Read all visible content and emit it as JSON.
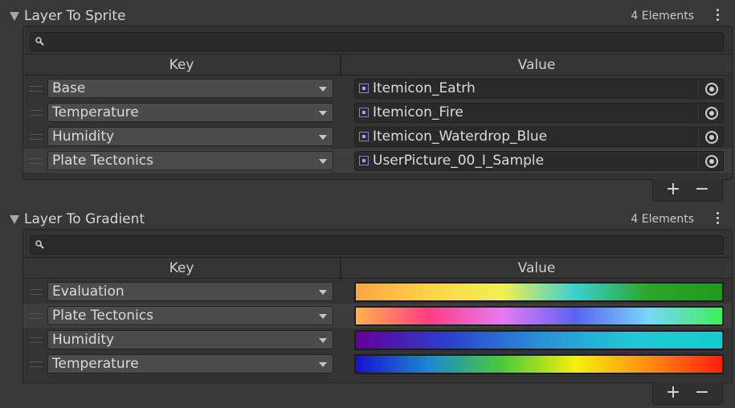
{
  "sections": [
    {
      "title": "Layer To Sprite",
      "count": "4 Elements",
      "col_key": "Key",
      "col_value": "Value",
      "rows": [
        {
          "key": "Base",
          "value": "Itemicon_Eatrh"
        },
        {
          "key": "Temperature",
          "value": "Itemicon_Fire"
        },
        {
          "key": "Humidity",
          "value": "Itemicon_Waterdrop_Blue"
        },
        {
          "key": "Plate Tectonics",
          "value": "UserPicture_00_I_Sample"
        }
      ]
    },
    {
      "title": "Layer To Gradient",
      "count": "4 Elements",
      "col_key": "Key",
      "col_value": "Value",
      "rows": [
        {
          "key": "Evaluation",
          "gradient": [
            "#fca641",
            "#fcd348",
            "#f2f052",
            "#39cfcf",
            "#2ca62a",
            "#1f9a1f"
          ]
        },
        {
          "key": "Plate Tectonics",
          "gradient": [
            "#ffb24a",
            "#ff3c83",
            "#e57bf2",
            "#5a63f3",
            "#7ad6f9",
            "#39f15b"
          ]
        },
        {
          "key": "Humidity",
          "gradient": [
            "#640099",
            "#2a3fd0",
            "#2c8fd7",
            "#1fc8d4",
            "#12cdd0"
          ]
        },
        {
          "key": "Temperature",
          "gradient": [
            "#1b0fd1",
            "#1c88d0",
            "#49ca3a",
            "#f3f00b",
            "#ff8c12",
            "#ff1d0d"
          ]
        }
      ]
    }
  ],
  "buttons": {
    "add": "+",
    "remove": "−"
  }
}
